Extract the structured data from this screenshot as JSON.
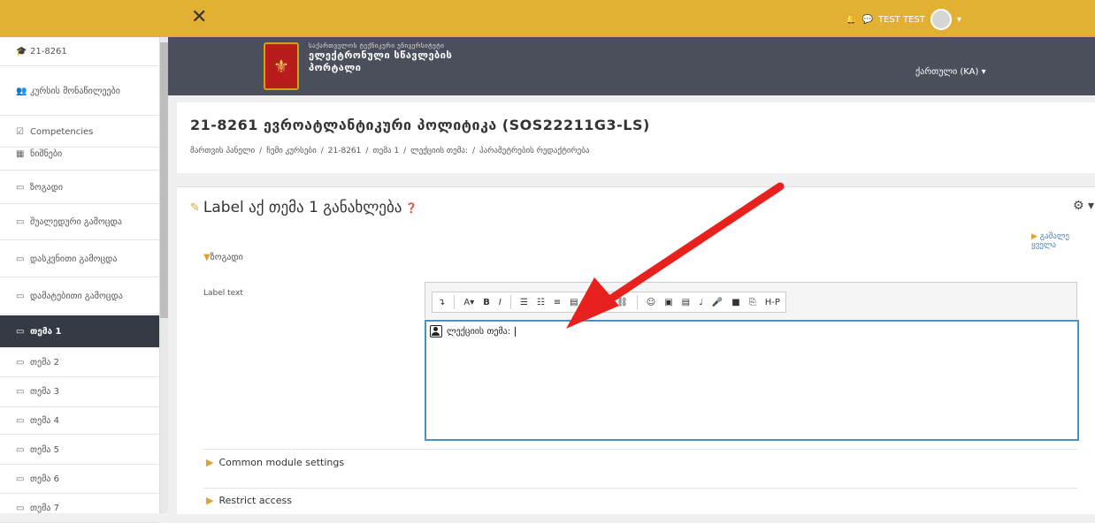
{
  "topbar": {
    "close_icon": "close-icon",
    "user_name": "TEST TEST"
  },
  "sidebar": {
    "items": [
      {
        "icon": "graduation-cap-icon",
        "glyph": "🎓",
        "label": "21-8261"
      },
      {
        "icon": "users-icon",
        "glyph": "👥",
        "label": "კურსის მონაწილეები"
      },
      {
        "icon": "checkbox-icon",
        "glyph": "☑",
        "label": "Competencies"
      },
      {
        "icon": "table-icon",
        "glyph": "▦",
        "label": "ნიშნები"
      },
      {
        "icon": "folder-icon",
        "glyph": "▭",
        "label": "ზოგადი"
      },
      {
        "icon": "folder-icon",
        "glyph": "▭",
        "label": "შუალედური გამოცდა"
      },
      {
        "icon": "folder-icon",
        "glyph": "▭",
        "label": "დასკვნითი გამოცდა"
      },
      {
        "icon": "folder-icon",
        "glyph": "▭",
        "label": "დამატებითი გამოცდა"
      },
      {
        "icon": "folder-icon",
        "glyph": "▭",
        "label": "თემა 1"
      },
      {
        "icon": "folder-icon",
        "glyph": "▭",
        "label": "თემა 2"
      },
      {
        "icon": "folder-icon",
        "glyph": "▭",
        "label": "თემა 3"
      },
      {
        "icon": "folder-icon",
        "glyph": "▭",
        "label": "თემა 4"
      },
      {
        "icon": "folder-icon",
        "glyph": "▭",
        "label": "თემა 5"
      },
      {
        "icon": "folder-icon",
        "glyph": "▭",
        "label": "თემა 6"
      },
      {
        "icon": "folder-icon",
        "glyph": "▭",
        "label": "თემა 7"
      }
    ],
    "active_index": 8
  },
  "banner": {
    "emblem": "⚜",
    "subtitle": "საქართველოს ტექნიკური უნივერსიტეტი",
    "title_line1": "ელექტრონული სწავლების",
    "title_line2": "პორტალი",
    "language": "ქართული (KA) ▾"
  },
  "course": {
    "title": "21-8261 ევროატლანტიკური პოლიტიკა (SOS22211G3-LS)",
    "breadcrumb": [
      "მართვის პანელი",
      "ჩემი კურსები",
      "21-8261",
      "თემა 1",
      "ლექციის თემა:",
      "პარამეტრების რედაქტირება"
    ]
  },
  "main": {
    "heading": "Label აქ თემა 1 განახლება",
    "expand_all": "გაშალე ყველა",
    "general": "ზოგადი",
    "label_text": "Label text",
    "editor_text": "ლექციის თემა:",
    "common_settings": "Common module settings",
    "restrict_access": "Restrict access"
  },
  "toolbar": {
    "buttons": [
      "↴",
      "A▾",
      "B",
      "I",
      "☰",
      "☷",
      "≡",
      "▤",
      "🔗",
      "⛓",
      "☺",
      "▣",
      "▤",
      "♩",
      "🎤",
      "■",
      "⎘",
      "H-P"
    ]
  },
  "colors": {
    "topbar": "#e2b133",
    "banner": "#4b4f5c",
    "active_nav": "#363a44",
    "arrow": "#e8201e",
    "editor_border": "#4a90c8"
  }
}
